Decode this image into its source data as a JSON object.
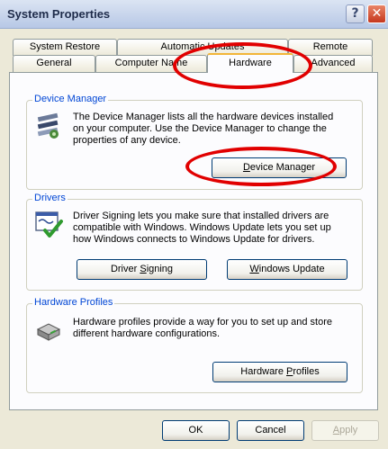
{
  "window": {
    "title": "System Properties",
    "help_glyph": "?",
    "close_glyph": "✕"
  },
  "tabs": {
    "row1": [
      "System Restore",
      "Automatic Updates",
      "Remote"
    ],
    "row2": [
      "General",
      "Computer Name",
      "Hardware",
      "Advanced"
    ],
    "active": "Hardware"
  },
  "device_manager": {
    "legend": "Device Manager",
    "line1": "The Device Manager lists all the hardware devices installed",
    "line2": "on your computer. Use the Device Manager to change the",
    "line3": "properties of any device.",
    "button_prefix": "",
    "button_key": "D",
    "button_rest": "evice Manager"
  },
  "drivers": {
    "legend": "Drivers",
    "line1": "Driver Signing lets you make sure that installed drivers are",
    "line2": "compatible with Windows. Windows Update lets you set up",
    "line3": "how Windows connects to Windows Update for drivers.",
    "signing_prefix": "Driver ",
    "signing_key": "S",
    "signing_rest": "igning",
    "update_prefix": "",
    "update_key": "W",
    "update_rest": "indows Update"
  },
  "hardware_profiles": {
    "legend": "Hardware Profiles",
    "line1": "Hardware profiles provide a way for you to set up and store",
    "line2": "different hardware configurations.",
    "button_prefix": "Hardware ",
    "button_key": "P",
    "button_rest": "rofiles"
  },
  "footer": {
    "ok": "OK",
    "cancel": "Cancel",
    "apply_key": "A",
    "apply_rest": "pply"
  },
  "colors": {
    "annotation": "#e10000",
    "group_label": "#0046d5"
  }
}
